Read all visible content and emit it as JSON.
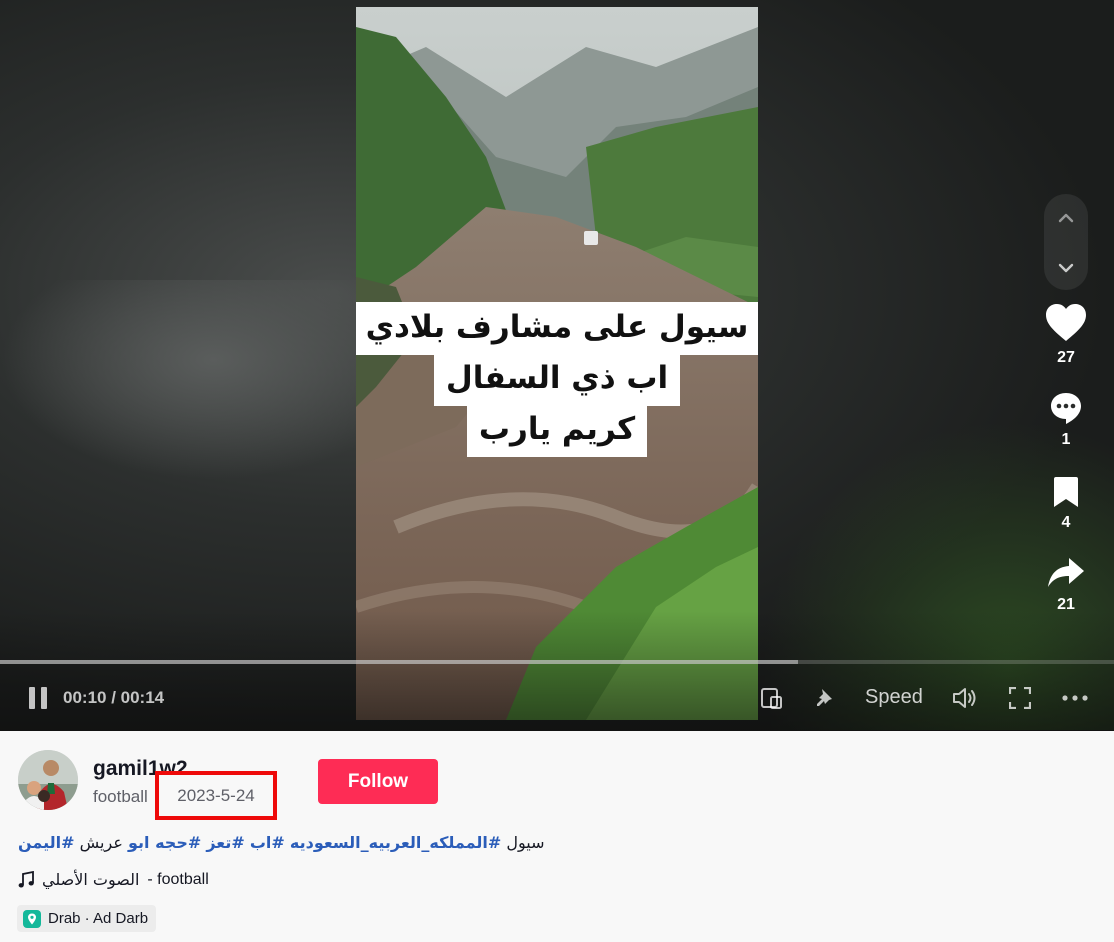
{
  "player": {
    "caption_lines": [
      "سيول على مشارف بلادي",
      "اب ذي السفال",
      "كريم يارب"
    ],
    "time_display": "00:10 / 00:14",
    "speed_label": "Speed",
    "progress_fraction": 0.716
  },
  "actions": {
    "likes": "27",
    "comments": "1",
    "saves": "4",
    "shares": "21"
  },
  "author": {
    "username": "gamil1w2",
    "nickname": "football",
    "post_date": "2023-5-24",
    "follow_label": "Follow"
  },
  "description": {
    "text": "سيول",
    "hashtags": [
      "#المملكه_العربيه_السعوديه",
      "#اب",
      "#تعز",
      "#حجه ابو",
      "عريش",
      "#اليمن"
    ]
  },
  "music": {
    "title_arabic": "الصوت الأصلي",
    "title_suffix": "- football"
  },
  "location": {
    "label": "Drab · Ad Darb"
  },
  "colors": {
    "follow": "#fe2c55",
    "hashtag": "#2b5db9",
    "highlight_box": "#ee0a0a",
    "location_pin": "#14b89a"
  },
  "icons": [
    "chevron-up-icon",
    "chevron-down-icon",
    "heart-icon",
    "comment-icon",
    "bookmark-icon",
    "share-icon",
    "pause-icon",
    "floating-player-icon",
    "pin-icon",
    "volume-icon",
    "fullscreen-icon",
    "more-icon",
    "music-note-icon",
    "location-pin-icon"
  ]
}
